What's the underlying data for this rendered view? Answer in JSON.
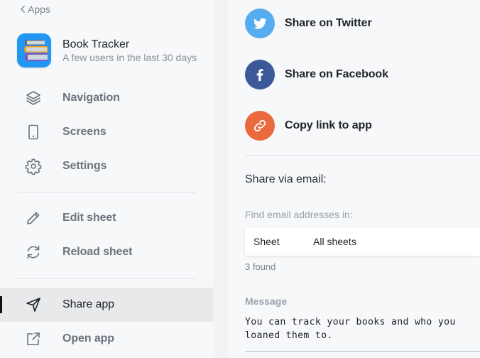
{
  "sidebar": {
    "back_label": "Apps",
    "app": {
      "title": "Book Tracker",
      "subtitle": "A few users in the last 30 days",
      "icon": "books-icon"
    },
    "groups": [
      [
        {
          "label": "Navigation",
          "icon": "layers-icon"
        },
        {
          "label": "Screens",
          "icon": "phone-icon"
        },
        {
          "label": "Settings",
          "icon": "gear-icon"
        }
      ],
      [
        {
          "label": "Edit sheet",
          "icon": "pencil-icon"
        },
        {
          "label": "Reload sheet",
          "icon": "refresh-icon"
        }
      ],
      [
        {
          "label": "Share app",
          "icon": "send-icon",
          "active": true
        },
        {
          "label": "Open app",
          "icon": "external-link-icon"
        }
      ]
    ]
  },
  "share": {
    "options": [
      {
        "label": "Share on Twitter",
        "icon": "twitter-icon",
        "color": "#55acee"
      },
      {
        "label": "Share on Facebook",
        "icon": "facebook-icon",
        "color": "#3b5998"
      },
      {
        "label": "Copy link to app",
        "icon": "link-icon",
        "color": "#ea6a3d"
      }
    ],
    "email": {
      "heading": "Share via email:",
      "find_label": "Find email addresses in:",
      "field_key": "Sheet",
      "field_value": "All sheets",
      "found": "3 found",
      "message_label": "Message",
      "message": "You can track your books and who you loaned them to."
    }
  }
}
